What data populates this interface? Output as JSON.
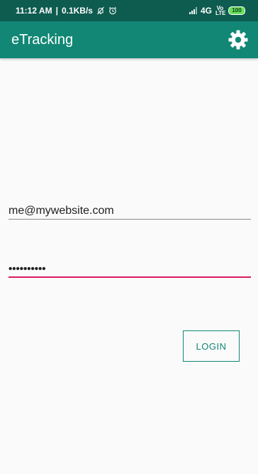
{
  "status_bar": {
    "time": "11:12 AM",
    "separator": "|",
    "speed": "0.1KB/s",
    "network": "4G",
    "volte_top": "Vo",
    "volte_bottom": "LTE",
    "battery": "100"
  },
  "app_bar": {
    "title": "eTracking",
    "settings_icon": "gear-icon"
  },
  "form": {
    "email_value": "me@mywebsite.com",
    "password_value": "••••••••••",
    "login_label": "LOGIN"
  },
  "colors": {
    "status_bar": "#0e5b4f",
    "app_bar": "#128775",
    "accent": "#d81b60",
    "background": "#fafafa"
  }
}
